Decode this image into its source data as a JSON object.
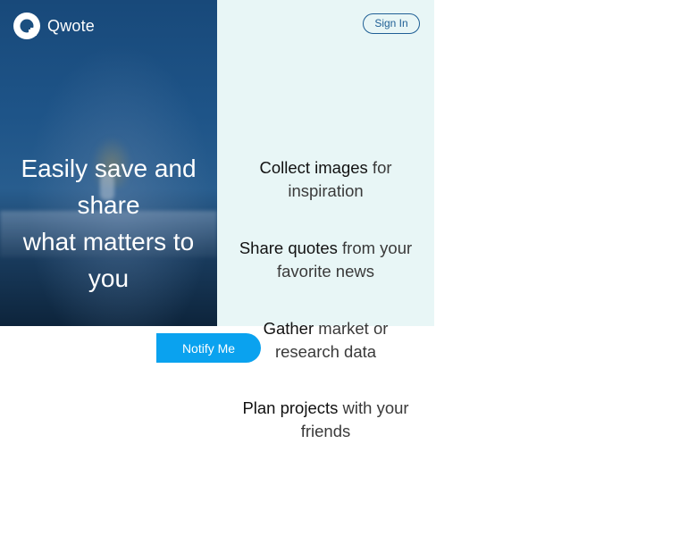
{
  "brand": {
    "name": "Qwote",
    "logo_icon": "q-logo-icon"
  },
  "header": {
    "sign_in_label": "Sign In"
  },
  "hero": {
    "lines": [
      "Easily save and",
      "share",
      "what matters to",
      "you"
    ]
  },
  "features": [
    {
      "strong": "Collect images",
      "rest_line1": " for",
      "line2": "inspiration"
    },
    {
      "strong": "Share quotes",
      "rest_line1": " from your",
      "line2": "favorite news"
    },
    {
      "strong": "Gather",
      "rest_line1": " market or",
      "line2": "research data"
    },
    {
      "strong": "Plan projects",
      "rest_line1": " with your",
      "line2": "friends"
    }
  ],
  "cta": {
    "notify_label": "Notify Me"
  },
  "colors": {
    "hero_bg": "#1e5488",
    "features_bg": "#e8f6f6",
    "signin_border": "#1f5f95",
    "notify_bg": "#0aa2ef"
  }
}
